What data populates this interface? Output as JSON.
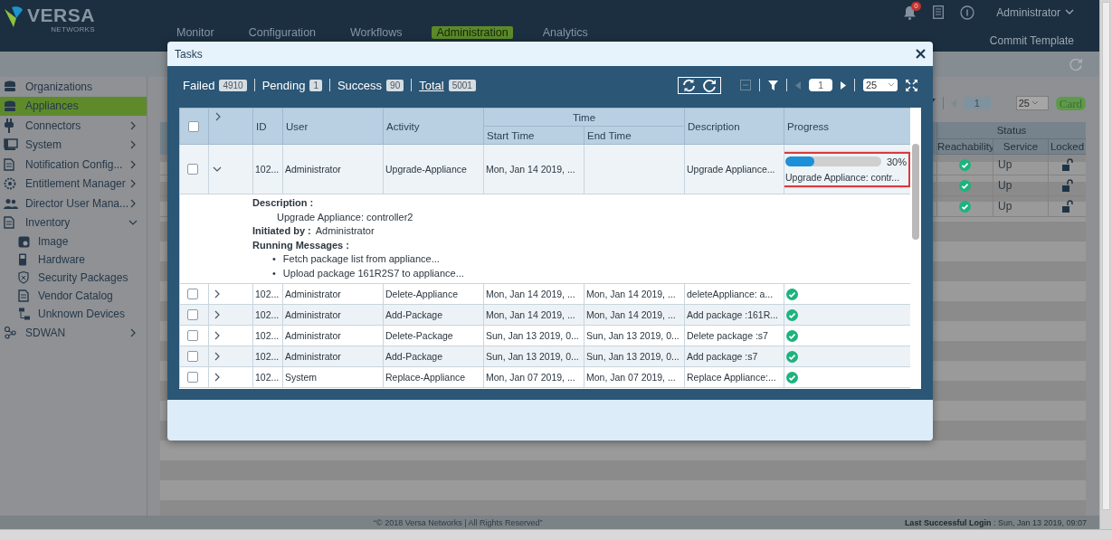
{
  "header": {
    "logo": {
      "name": "VERSA",
      "tagline": "NETWORKS"
    },
    "notifications_badge": "0",
    "user_menu": "Administrator",
    "nav_tabs": [
      {
        "label": "Monitor",
        "selected": false
      },
      {
        "label": "Configuration",
        "selected": false
      },
      {
        "label": "Workflows",
        "selected": false
      },
      {
        "label": "Administration",
        "selected": true
      },
      {
        "label": "Analytics",
        "selected": false
      }
    ],
    "commit_template": "Commit Template"
  },
  "sidebar": {
    "items": [
      {
        "label": "Organizations",
        "kind": "link",
        "selected": false
      },
      {
        "label": "Appliances",
        "kind": "link",
        "selected": true
      },
      {
        "label": "Connectors",
        "kind": "menu",
        "selected": false,
        "expanded": false
      },
      {
        "label": "System",
        "kind": "menu",
        "selected": false,
        "expanded": false
      },
      {
        "label": "Notification Config...",
        "kind": "menu",
        "selected": false,
        "expanded": false
      },
      {
        "label": "Entitlement Manager",
        "kind": "menu",
        "selected": false,
        "expanded": false
      },
      {
        "label": "Director User Mana...",
        "kind": "menu",
        "selected": false,
        "expanded": false
      },
      {
        "label": "Inventory",
        "kind": "menu",
        "selected": false,
        "expanded": true,
        "children": [
          {
            "label": "Image",
            "selected": false
          },
          {
            "label": "Hardware",
            "selected": false
          },
          {
            "label": "Security Packages",
            "selected": false
          },
          {
            "label": "Vendor Catalog",
            "selected": false
          },
          {
            "label": "Unknown Devices",
            "selected": false
          }
        ]
      },
      {
        "label": "SDWAN",
        "kind": "menu",
        "selected": false,
        "expanded": false
      }
    ]
  },
  "main": {
    "toolbar": {
      "page": "1",
      "page_size": "25",
      "view_button": "Card"
    },
    "table": {
      "group": "Status",
      "columns": [
        "Reachability",
        "Service",
        "Locked"
      ],
      "rows": [
        {
          "reachable": true,
          "service": "Up",
          "locked": false
        },
        {
          "reachable": true,
          "service": "Up",
          "locked": false
        },
        {
          "reachable": true,
          "service": "Up",
          "locked": false
        }
      ]
    }
  },
  "footer": {
    "copyright": "“© 2018 Versa Networks | All Rights Reserved”",
    "last_login": "**Last Successful Login** : Sun, Jan 13 2019, 09:07"
  },
  "tasks_dialog": {
    "title": "Tasks",
    "stats": [
      {
        "label": "Failed",
        "count": "4910",
        "kind": "plain"
      },
      {
        "label": "Pending",
        "count": "1",
        "kind": "plain"
      },
      {
        "label": "Success",
        "count": "90",
        "kind": "plain"
      },
      {
        "label": "Total",
        "count": "5001",
        "kind": "link"
      }
    ],
    "pager": {
      "page": "1",
      "page_size": "25"
    },
    "table": {
      "select_all": {
        "checked": false
      },
      "expand_all": {
        "expanded": false
      },
      "columns": [
        {
          "label": "ID"
        },
        {
          "label": "User"
        },
        {
          "label": "Activity"
        },
        {
          "label": "Time",
          "children": [
            {
              "label": "Start Time"
            },
            {
              "label": "End Time"
            }
          ]
        },
        {
          "label": "Description"
        },
        {
          "label": "Progress"
        }
      ],
      "rows": [
        {
          "checked": false,
          "expanded": true,
          "id": "102...",
          "user": "Administrator",
          "activity": "Upgrade-Appliance",
          "start_time": "Mon, Jan 14 2019, ...",
          "description": "Upgrade Appliance...",
          "progress": {
            "kind": "bar",
            "level": 0.3,
            "percent": "30%",
            "message": "Upgrade Appliance: contr...",
            "highlighted": true
          },
          "details": {
            "description_label": "Description :",
            "description": "Upgrade Appliance: controller2",
            "initiated_label": "Initiated by :",
            "initiated_by": "Administrator",
            "messages_label": "Running Messages :",
            "bullet": "•",
            "messages": [
              "Fetch package list from appliance...",
              "Upload package 161R2S7 to appliance..."
            ]
          }
        },
        {
          "checked": false,
          "expanded": false,
          "id": "102...",
          "user": "Administrator",
          "activity": "Delete-Appliance",
          "start_time": "Mon, Jan 14 2019, ...",
          "end_time": "Mon, Jan 14 2019, ...",
          "description": "deleteAppliance: a...",
          "progress": {
            "kind": "done"
          }
        },
        {
          "checked": false,
          "expanded": false,
          "id": "102...",
          "user": "Administrator",
          "activity": "Add-Package",
          "start_time": "Mon, Jan 14 2019, ...",
          "end_time": "Mon, Jan 14 2019, ...",
          "description": "Add package :161R...",
          "progress": {
            "kind": "done"
          }
        },
        {
          "checked": false,
          "expanded": false,
          "id": "102...",
          "user": "Administrator",
          "activity": "Delete-Package",
          "start_time": "Sun, Jan 13 2019, 0...",
          "end_time": "Sun, Jan 13 2019, 0...",
          "description": "Delete package :s7",
          "progress": {
            "kind": "done"
          }
        },
        {
          "checked": false,
          "expanded": false,
          "id": "102...",
          "user": "Administrator",
          "activity": "Add-Package",
          "start_time": "Sun, Jan 13 2019, 0...",
          "end_time": "Sun, Jan 13 2019, 0...",
          "description": "Add package :s7",
          "progress": {
            "kind": "done"
          }
        },
        {
          "checked": false,
          "expanded": false,
          "id": "102...",
          "user": "System",
          "activity": "Replace-Appliance",
          "start_time": "Mon, Jan 07 2019, ...",
          "end_time": "Mon, Jan 07 2019, ...",
          "description": "Replace Appliance:...",
          "progress": {
            "kind": "done"
          }
        }
      ]
    }
  }
}
